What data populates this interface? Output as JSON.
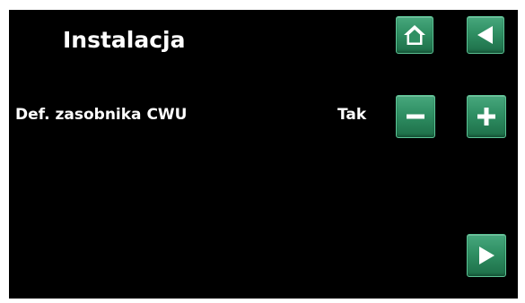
{
  "header": {
    "title": "Instalacja"
  },
  "toolbar": {
    "home_icon": "home-icon",
    "back_icon": "back-arrow-icon"
  },
  "setting": {
    "label": "Def. zasobnika CWU",
    "value": "Tak"
  },
  "controls": {
    "minus_icon": "minus-icon",
    "plus_icon": "plus-icon",
    "next_icon": "next-arrow-icon"
  },
  "colors": {
    "background": "#000000",
    "button": "#2f8f63",
    "text": "#ffffff"
  }
}
